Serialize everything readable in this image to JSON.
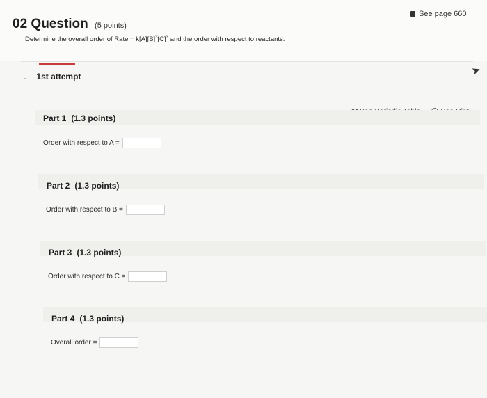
{
  "question": {
    "number": "02",
    "title_word": "Question",
    "points": "(5 points)",
    "prompt_prefix": "Determine the overall order of Rate = k[A][B]",
    "prompt_exp1": "3",
    "prompt_mid": "[C]",
    "prompt_exp2": "3",
    "prompt_suffix": " and the order with respect to reactants."
  },
  "see_page": "See page 660",
  "attempt_label": "1st attempt",
  "tools": {
    "periodic_table": "See Periodic Table",
    "hint": "See Hint"
  },
  "parts": [
    {
      "title": "Part 1",
      "points": "(1.3 points)",
      "label": "Order with respect to A =",
      "value": ""
    },
    {
      "title": "Part 2",
      "points": "(1.3 points)",
      "label": "Order with respect to B =",
      "value": ""
    },
    {
      "title": "Part 3",
      "points": "(1.3 points)",
      "label": "Order with respect to C =",
      "value": ""
    },
    {
      "title": "Part 4",
      "points": "(1.3 points)",
      "label": "Overall order =",
      "value": ""
    }
  ]
}
